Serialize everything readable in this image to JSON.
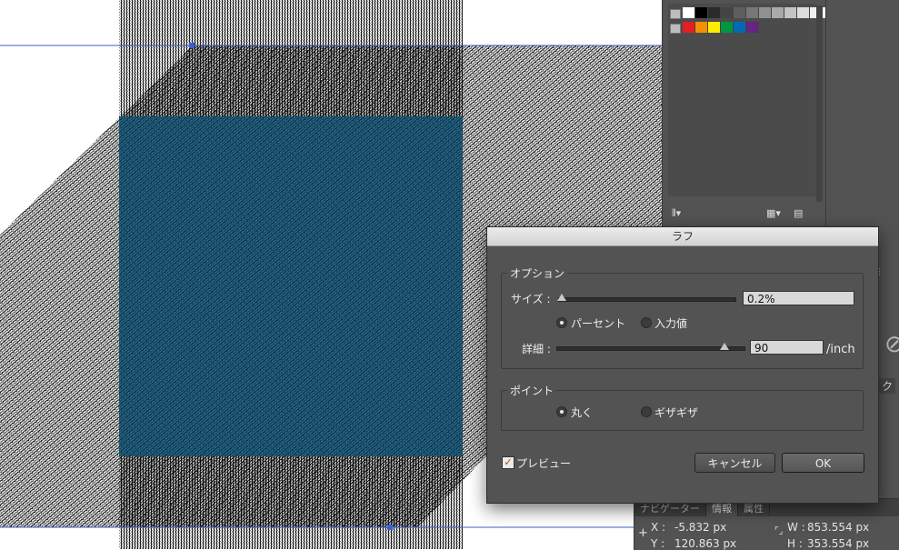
{
  "dialog": {
    "title": "ラフ",
    "options_group": "オプション",
    "size_label": "サイズ :",
    "size_value": "0.2%",
    "size_level": 0.02,
    "radio_percent": "パーセント",
    "radio_absolute": "入力値",
    "detail_label": "詳細 :",
    "detail_value": "90",
    "detail_unit": "/inch",
    "detail_level": 0.9,
    "points_group": "ポイント",
    "radio_smooth": "丸く",
    "radio_corner": "ギザギザ",
    "preview_label": "プレビュー",
    "preview_checked": "✓",
    "cancel_label": "キャンセル",
    "ok_label": "OK"
  },
  "info_panel": {
    "tabs": [
      "ナビゲーター",
      "情報",
      "属性"
    ],
    "x_label": "X :",
    "x_value": "-5.832 px",
    "y_label": "Y :",
    "y_value": "120.863 px",
    "w_label": "W :",
    "w_value": "853.554 px",
    "h_label": "H :",
    "h_value": "353.554 px"
  },
  "right_strip": {
    "partial_tab": "ク"
  },
  "colors": {
    "fill_blue": "#1f6b94",
    "panel_gray": "#535353",
    "selection_blue": "#3a5fd0",
    "swatches": [
      "#ffffff",
      "#000000",
      "#2b2b2b",
      "#444444",
      "#5e5e5e",
      "#777777",
      "#919191",
      "#aaaaaa",
      "#c4c4c4",
      "#dddddd",
      "#eeeeee",
      "#f7f7f7"
    ],
    "color_swatches": [
      "#e31e24",
      "#f39200",
      "#ffed00",
      "#009640",
      "#0069b4",
      "#662483"
    ]
  },
  "icons": [
    "library-icon",
    "new-swatch-icon",
    "swatch-list-icon",
    "no-stroke-icon",
    "crosshair-icon"
  ]
}
